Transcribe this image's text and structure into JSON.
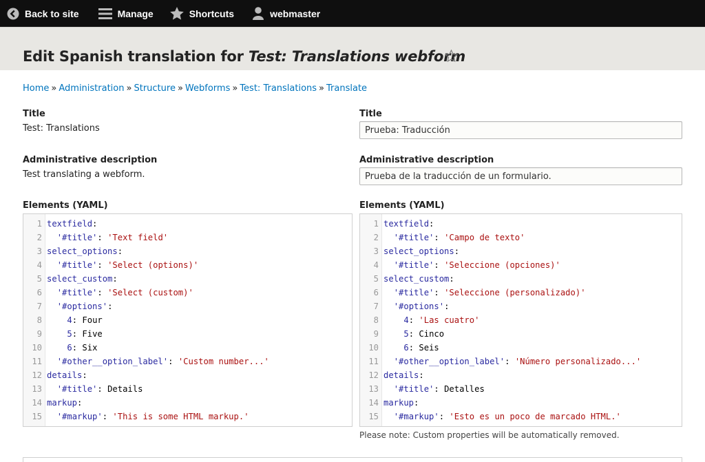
{
  "toolbar": {
    "back": "Back to site",
    "manage": "Manage",
    "shortcuts": "Shortcuts",
    "user": "webmaster"
  },
  "page": {
    "title_prefix": "Edit Spanish translation for ",
    "title_em": "Test: Translations webform"
  },
  "breadcrumb": [
    "Home",
    "Administration",
    "Structure",
    "Webforms",
    "Test: Translations",
    "Translate"
  ],
  "source": {
    "title_label": "Title",
    "title_value": "Test: Translations",
    "desc_label": "Administrative description",
    "desc_value": "Test translating a webform.",
    "elements_label": "Elements (YAML)"
  },
  "translation": {
    "title_label": "Title",
    "title_value": "Prueba: Traducción",
    "desc_label": "Administrative description",
    "desc_value": "Prueba de la traducción de un formulario.",
    "elements_label": "Elements (YAML)",
    "note": "Please note: Custom properties will be automatically removed."
  },
  "source_yaml": [
    {
      "n": "1",
      "indent": "",
      "key": "textfield",
      "sep": ":",
      "val": "",
      "vt": ""
    },
    {
      "n": "2",
      "indent": "  ",
      "key": "'#title'",
      "sep": ": ",
      "val": "'Text field'",
      "vt": "s"
    },
    {
      "n": "3",
      "indent": "",
      "key": "select_options",
      "sep": ":",
      "val": "",
      "vt": ""
    },
    {
      "n": "4",
      "indent": "  ",
      "key": "'#title'",
      "sep": ": ",
      "val": "'Select (options)'",
      "vt": "s"
    },
    {
      "n": "5",
      "indent": "",
      "key": "select_custom",
      "sep": ":",
      "val": "",
      "vt": ""
    },
    {
      "n": "6",
      "indent": "  ",
      "key": "'#title'",
      "sep": ": ",
      "val": "'Select (custom)'",
      "vt": "s"
    },
    {
      "n": "7",
      "indent": "  ",
      "key": "'#options'",
      "sep": ":",
      "val": "",
      "vt": ""
    },
    {
      "n": "8",
      "indent": "    ",
      "key": "4",
      "sep": ": ",
      "val": "Four",
      "vt": "p"
    },
    {
      "n": "9",
      "indent": "    ",
      "key": "5",
      "sep": ": ",
      "val": "Five",
      "vt": "p"
    },
    {
      "n": "10",
      "indent": "    ",
      "key": "6",
      "sep": ": ",
      "val": "Six",
      "vt": "p"
    },
    {
      "n": "11",
      "indent": "  ",
      "key": "'#other__option_label'",
      "sep": ": ",
      "val": "'Custom number...'",
      "vt": "s"
    },
    {
      "n": "12",
      "indent": "",
      "key": "details",
      "sep": ":",
      "val": "",
      "vt": ""
    },
    {
      "n": "13",
      "indent": "  ",
      "key": "'#title'",
      "sep": ": ",
      "val": "Details",
      "vt": "p"
    },
    {
      "n": "14",
      "indent": "",
      "key": "markup",
      "sep": ":",
      "val": "",
      "vt": ""
    },
    {
      "n": "15",
      "indent": "  ",
      "key": "'#markup'",
      "sep": ": ",
      "val": "'This is some HTML markup.'",
      "vt": "s"
    }
  ],
  "translation_yaml": [
    {
      "n": "1",
      "indent": "",
      "key": "textfield",
      "sep": ":",
      "val": "",
      "vt": ""
    },
    {
      "n": "2",
      "indent": "  ",
      "key": "'#title'",
      "sep": ": ",
      "val": "'Campo de texto'",
      "vt": "s"
    },
    {
      "n": "3",
      "indent": "",
      "key": "select_options",
      "sep": ":",
      "val": "",
      "vt": ""
    },
    {
      "n": "4",
      "indent": "  ",
      "key": "'#title'",
      "sep": ": ",
      "val": "'Seleccione (opciones)'",
      "vt": "s"
    },
    {
      "n": "5",
      "indent": "",
      "key": "select_custom",
      "sep": ":",
      "val": "",
      "vt": ""
    },
    {
      "n": "6",
      "indent": "  ",
      "key": "'#title'",
      "sep": ": ",
      "val": "'Seleccione (personalizado)'",
      "vt": "s"
    },
    {
      "n": "7",
      "indent": "  ",
      "key": "'#options'",
      "sep": ":",
      "val": "",
      "vt": ""
    },
    {
      "n": "8",
      "indent": "    ",
      "key": "4",
      "sep": ": ",
      "val": "'Las cuatro'",
      "vt": "s"
    },
    {
      "n": "9",
      "indent": "    ",
      "key": "5",
      "sep": ": ",
      "val": "Cinco",
      "vt": "p"
    },
    {
      "n": "10",
      "indent": "    ",
      "key": "6",
      "sep": ": ",
      "val": "Seis",
      "vt": "p"
    },
    {
      "n": "11",
      "indent": "  ",
      "key": "'#other__option_label'",
      "sep": ": ",
      "val": "'Número personalizado...'",
      "vt": "s"
    },
    {
      "n": "12",
      "indent": "",
      "key": "details",
      "sep": ":",
      "val": "",
      "vt": ""
    },
    {
      "n": "13",
      "indent": "  ",
      "key": "'#title'",
      "sep": ": ",
      "val": "Detalles",
      "vt": "p"
    },
    {
      "n": "14",
      "indent": "",
      "key": "markup",
      "sep": ":",
      "val": "",
      "vt": ""
    },
    {
      "n": "15",
      "indent": "  ",
      "key": "'#markup'",
      "sep": ": ",
      "val": "'Esto es un poco de marcado HTML.'",
      "vt": "s"
    }
  ]
}
